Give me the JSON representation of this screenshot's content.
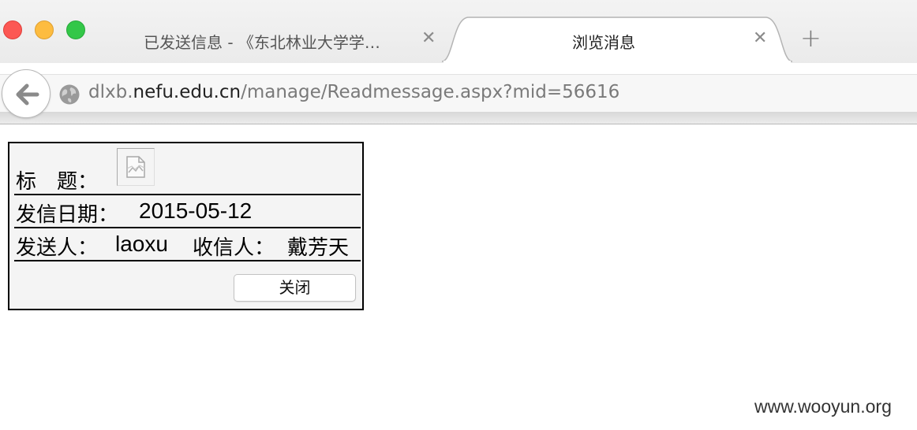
{
  "browser": {
    "tabs": [
      {
        "title": "已发送信息 - 《东北林业大学学…",
        "active": false,
        "close_symbol": "✕"
      },
      {
        "title": "浏览消息",
        "active": true,
        "close_symbol": "✕"
      }
    ],
    "new_tab_symbol": "+",
    "address": {
      "prefix": "dlxb.",
      "domain": "nefu.edu.cn",
      "path": "/manage/Readmessage.aspx?mid=56616"
    },
    "traffic_colors": {
      "close": "#fc5753",
      "minimize": "#fdbc40",
      "maximize": "#33c748"
    }
  },
  "message": {
    "title_label": "标　题：",
    "date_label": "发信日期：",
    "date_value": "2015-05-12",
    "sender_label": "发送人：",
    "sender_value": "laoxu",
    "receiver_label": "收信人：",
    "receiver_value": "戴芳天",
    "close_button": "关闭"
  },
  "watermark": "www.wooyun.org"
}
